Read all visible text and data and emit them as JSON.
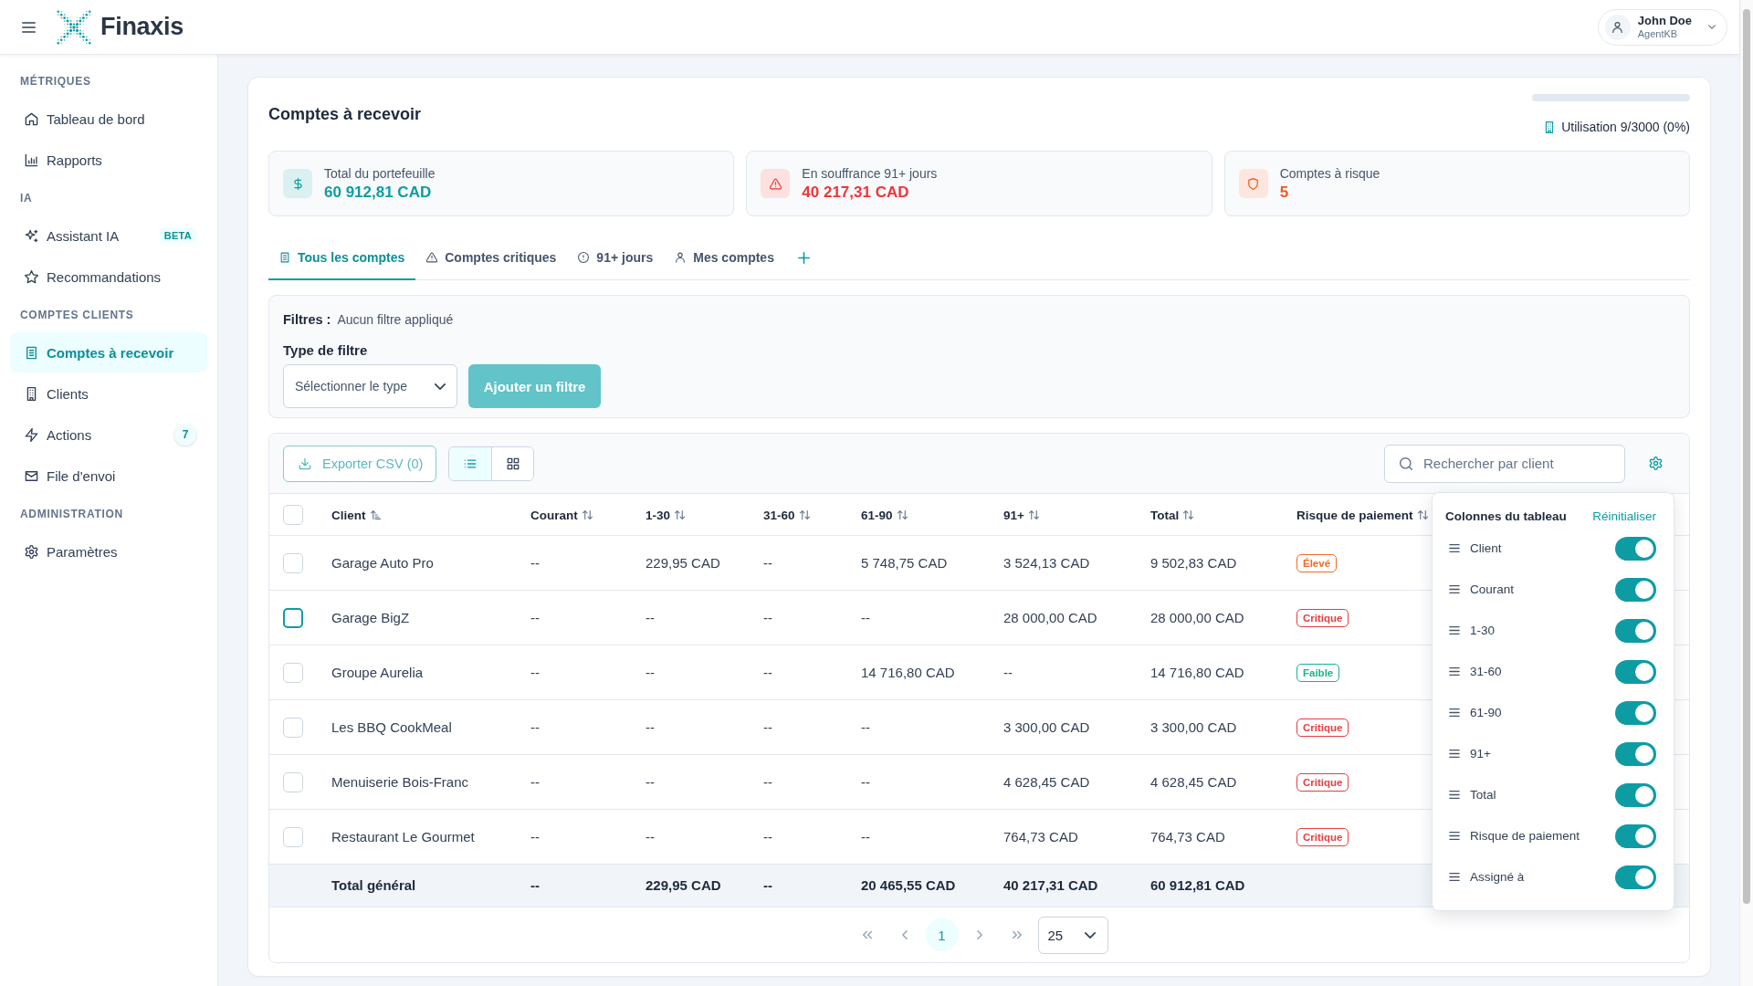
{
  "header": {
    "app_name": "Finaxis",
    "user": {
      "name": "John Doe",
      "role": "AgentKB"
    }
  },
  "sidebar": {
    "sections": [
      {
        "title": "MÉTRIQUES",
        "items": [
          {
            "label": "Tableau de bord",
            "selected": false
          },
          {
            "label": "Rapports",
            "selected": false
          }
        ]
      },
      {
        "title": "IA",
        "items": [
          {
            "label": "Assistant IA",
            "selected": false,
            "badge": "BETA"
          },
          {
            "label": "Recommandations",
            "selected": false
          }
        ]
      },
      {
        "title": "COMPTES CLIENTS",
        "items": [
          {
            "label": "Comptes à recevoir",
            "selected": true
          },
          {
            "label": "Clients",
            "selected": false
          },
          {
            "label": "Actions",
            "selected": false,
            "count": "7"
          },
          {
            "label": "File d'envoi",
            "selected": false
          }
        ]
      },
      {
        "title": "ADMINISTRATION",
        "items": [
          {
            "label": "Paramètres",
            "selected": false
          }
        ]
      }
    ]
  },
  "page": {
    "title": "Comptes à recevoir",
    "usage": {
      "level": 0,
      "label": "Utilisation 9/3000 (0%)"
    },
    "stats": [
      {
        "label": "Total du portefeuille",
        "value": "60 912,81 CAD",
        "color": "#0e9ca4"
      },
      {
        "label": "En souffrance 91+ jours",
        "value": "40 217,31 CAD",
        "color": "#ef3535"
      },
      {
        "label": "Comptes à risque",
        "value": "5",
        "color": "#f2581d"
      }
    ],
    "tabs": [
      {
        "label": "Tous les comptes",
        "selected": true
      },
      {
        "label": "Comptes critiques",
        "selected": false
      },
      {
        "label": "91+ jours",
        "selected": false
      },
      {
        "label": "Mes comptes",
        "selected": false
      }
    ],
    "filters": {
      "label": "Filtres :",
      "status": "Aucun filtre appliqué",
      "type_label": "Type de filtre",
      "type_select": {
        "placeholder": "Sélectionner le type"
      },
      "add_button": {
        "label": "Ajouter un filtre",
        "disabled": true
      }
    },
    "toolbar": {
      "export_button": {
        "label": "Exporter CSV (0)",
        "disabled": true
      },
      "view_modes": [
        {
          "selected": true
        },
        {
          "selected": false
        }
      ],
      "search": {
        "placeholder": "Rechercher par client"
      }
    },
    "table": {
      "select_all": {
        "checked": false
      },
      "columns": [
        {
          "label": "Client",
          "sorted": true
        },
        {
          "label": "Courant",
          "sorted": false
        },
        {
          "label": "1-30",
          "sorted": false
        },
        {
          "label": "31-60",
          "sorted": false
        },
        {
          "label": "61-90",
          "sorted": false
        },
        {
          "label": "91+",
          "sorted": false
        },
        {
          "label": "Total",
          "sorted": false
        },
        {
          "label": "Risque de paiement",
          "sorted": false
        }
      ],
      "rows": [
        {
          "checked": false,
          "focused": false,
          "client": "Garage Auto Pro",
          "amounts": [
            "--",
            "229,95 CAD",
            "--",
            "5 748,75 CAD",
            "3 524,13 CAD",
            "9 502,83 CAD"
          ],
          "risk": {
            "label": "Élevé",
            "color": "#f26a21"
          }
        },
        {
          "checked": false,
          "focused": true,
          "client": "Garage BigZ",
          "amounts": [
            "--",
            "--",
            "--",
            "--",
            "28 000,00 CAD",
            "28 000,00 CAD"
          ],
          "risk": {
            "label": "Critique",
            "color": "#e53e3e"
          }
        },
        {
          "checked": false,
          "focused": false,
          "client": "Groupe Aurelia",
          "amounts": [
            "--",
            "--",
            "--",
            "14 716,80 CAD",
            "--",
            "14 716,80 CAD"
          ],
          "risk": {
            "label": "Faible",
            "color": "#1bb28c"
          }
        },
        {
          "checked": false,
          "focused": false,
          "client": "Les BBQ CookMeal",
          "amounts": [
            "--",
            "--",
            "--",
            "--",
            "3 300,00 CAD",
            "3 300,00 CAD"
          ],
          "risk": {
            "label": "Critique",
            "color": "#e53e3e"
          }
        },
        {
          "checked": false,
          "focused": false,
          "client": "Menuiserie Bois-Franc",
          "amounts": [
            "--",
            "--",
            "--",
            "--",
            "4 628,45 CAD",
            "4 628,45 CAD"
          ],
          "risk": {
            "label": "Critique",
            "color": "#e53e3e"
          }
        },
        {
          "checked": false,
          "focused": false,
          "client": "Restaurant Le Gourmet",
          "amounts": [
            "--",
            "--",
            "--",
            "--",
            "764,73 CAD",
            "764,73 CAD"
          ],
          "risk": {
            "label": "Critique",
            "color": "#e53e3e"
          }
        }
      ],
      "total_row": {
        "label": "Total général",
        "amounts": [
          "--",
          "229,95 CAD",
          "--",
          "20 465,55 CAD",
          "40 217,31 CAD",
          "60 912,81 CAD"
        ]
      }
    },
    "pagination": {
      "pages": [
        {
          "label": "1",
          "selected": true
        }
      ],
      "page_size": "25"
    },
    "column_settings": {
      "title": "Colonnes du tableau",
      "reset": "Réinitialiser",
      "columns": [
        {
          "label": "Client",
          "on": true
        },
        {
          "label": "Courant",
          "on": true
        },
        {
          "label": "1-30",
          "on": true
        },
        {
          "label": "31-60",
          "on": true
        },
        {
          "label": "61-90",
          "on": true
        },
        {
          "label": "91+",
          "on": true
        },
        {
          "label": "Total",
          "on": true
        },
        {
          "label": "Risque de paiement",
          "on": true
        },
        {
          "label": "Assigné à",
          "on": true
        }
      ]
    }
  }
}
